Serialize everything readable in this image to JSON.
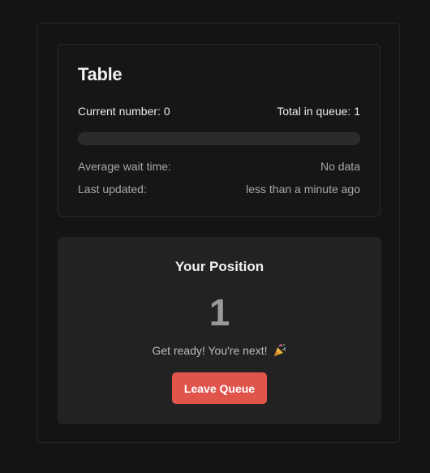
{
  "queue": {
    "title": "Table",
    "current_number_label": "Current number: 0",
    "total_in_queue_label": "Total in queue: 1",
    "progress_fraction": 0,
    "average_wait_label": "Average wait time:",
    "average_wait_value": "No data",
    "last_updated_label": "Last updated:",
    "last_updated_value": "less than a minute ago"
  },
  "position": {
    "title": "Your Position",
    "number": "1",
    "message": "Get ready! You're next!",
    "message_icon": "party-popper-icon",
    "leave_button_label": "Leave Queue"
  },
  "colors": {
    "background": "#141414",
    "card": "#222222",
    "accent_button": "#e0544c"
  }
}
